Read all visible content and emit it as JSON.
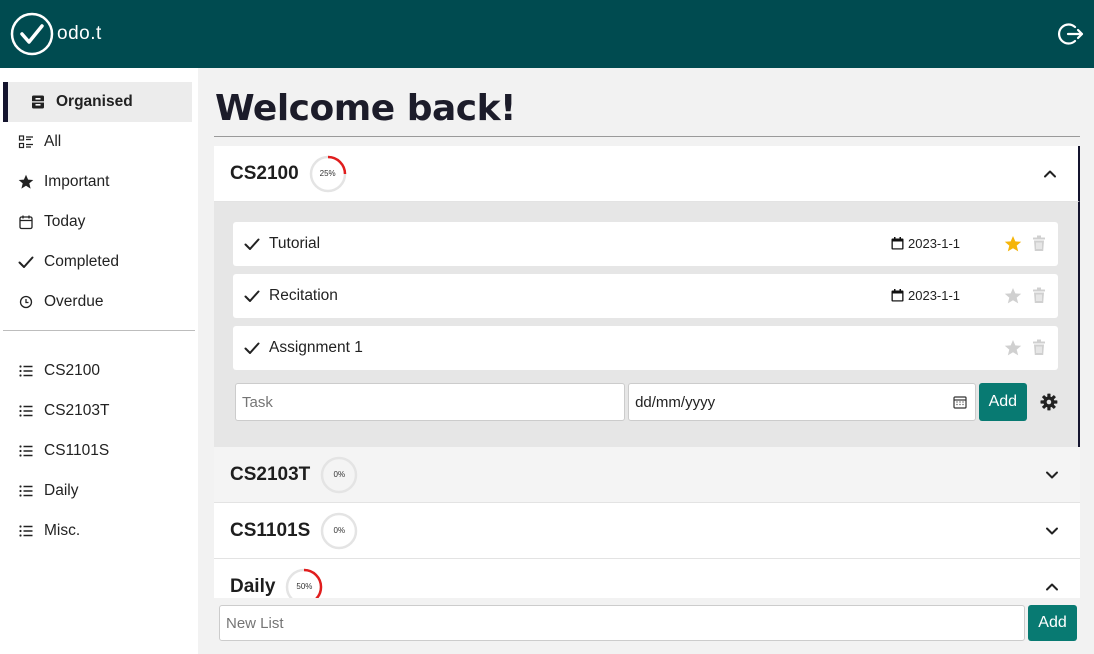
{
  "app": {
    "brand_text": "odo.t"
  },
  "sidebar": {
    "items": [
      {
        "label": "Organised",
        "icon": "archive-icon",
        "active": true
      },
      {
        "label": "All",
        "icon": "list-check-icon"
      },
      {
        "label": "Important",
        "icon": "star-icon"
      },
      {
        "label": "Today",
        "icon": "calendar-icon"
      },
      {
        "label": "Completed",
        "icon": "check-icon"
      },
      {
        "label": "Overdue",
        "icon": "clock-icon"
      }
    ],
    "lists": [
      {
        "label": "CS2100"
      },
      {
        "label": "CS2103T"
      },
      {
        "label": "CS1101S"
      },
      {
        "label": "Daily"
      },
      {
        "label": "Misc."
      }
    ]
  },
  "main": {
    "title": "Welcome back!",
    "lists": [
      {
        "name": "CS2100",
        "progress": 25,
        "progress_label": "25%",
        "expanded": true,
        "tasks": [
          {
            "name": "Tutorial",
            "date": "2023-1-1",
            "important": true
          },
          {
            "name": "Recitation",
            "date": "2023-1-1",
            "important": false
          },
          {
            "name": "Assignment 1",
            "date": "",
            "important": false
          }
        ],
        "task_placeholder": "Task",
        "date_placeholder": "dd/mm/yyyy",
        "add_label": "Add"
      },
      {
        "name": "CS2103T",
        "progress": 0,
        "progress_label": "0%",
        "expanded": false
      },
      {
        "name": "CS1101S",
        "progress": 0,
        "progress_label": "0%",
        "expanded": false
      },
      {
        "name": "Daily",
        "progress": 50,
        "progress_label": "50%",
        "expanded": true
      }
    ],
    "new_list_placeholder": "New List",
    "new_list_add_label": "Add"
  },
  "colors": {
    "topbar": "#004b50",
    "accent": "#087a72",
    "progress": "#e11d1d",
    "star_active": "#f5b50a"
  }
}
